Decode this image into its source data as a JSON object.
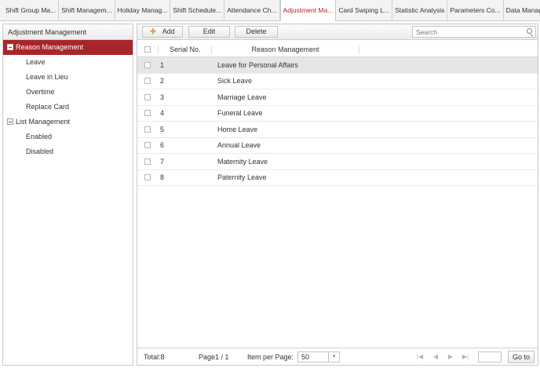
{
  "tabs": [
    {
      "label": "Shift Group Ma..."
    },
    {
      "label": "Shift Managem..."
    },
    {
      "label": "Holiday Manag..."
    },
    {
      "label": "Shift Schedule..."
    },
    {
      "label": "Attendance Ch..."
    },
    {
      "label": "Adjustment Ma..."
    },
    {
      "label": "Card Swiping L..."
    },
    {
      "label": "Statistic Analysis"
    },
    {
      "label": "Parameters Co..."
    },
    {
      "label": "Data Manage..."
    }
  ],
  "active_tab": "Adjustment Ma...",
  "sidebar": {
    "title": "Adjustment Management",
    "groups": [
      {
        "label": "Reason Management",
        "items": [
          "Leave",
          "Leave in Lieu",
          "Overtime",
          "Replace Card"
        ]
      },
      {
        "label": "List Management",
        "items": [
          "Enabled",
          "Disabled"
        ]
      }
    ]
  },
  "toolbar": {
    "add_label": "Add",
    "edit_label": "Edit",
    "delete_label": "Delete",
    "search_placeholder": "Search"
  },
  "table": {
    "columns": [
      "Serial No.",
      "Reason Management"
    ],
    "rows": [
      {
        "serial": "1",
        "name": "Leave for Personal Affairs"
      },
      {
        "serial": "2",
        "name": "Sick Leave"
      },
      {
        "serial": "3",
        "name": "Marriage Leave"
      },
      {
        "serial": "4",
        "name": "Funeral Leave"
      },
      {
        "serial": "5",
        "name": "Home Leave"
      },
      {
        "serial": "6",
        "name": "Annual Leave"
      },
      {
        "serial": "7",
        "name": "Maternity Leave"
      },
      {
        "serial": "8",
        "name": "Paternity Leave"
      }
    ]
  },
  "footer": {
    "total": "Total:8",
    "page": "Page1 / 1",
    "items_per_page_label": "Item per Page:",
    "items_per_page_value": "50",
    "goto_label": "Go to"
  },
  "colors": {
    "accent": "#a8262b",
    "active_tab_text": "#b8232b",
    "selected_row": "#e6e6e6"
  }
}
